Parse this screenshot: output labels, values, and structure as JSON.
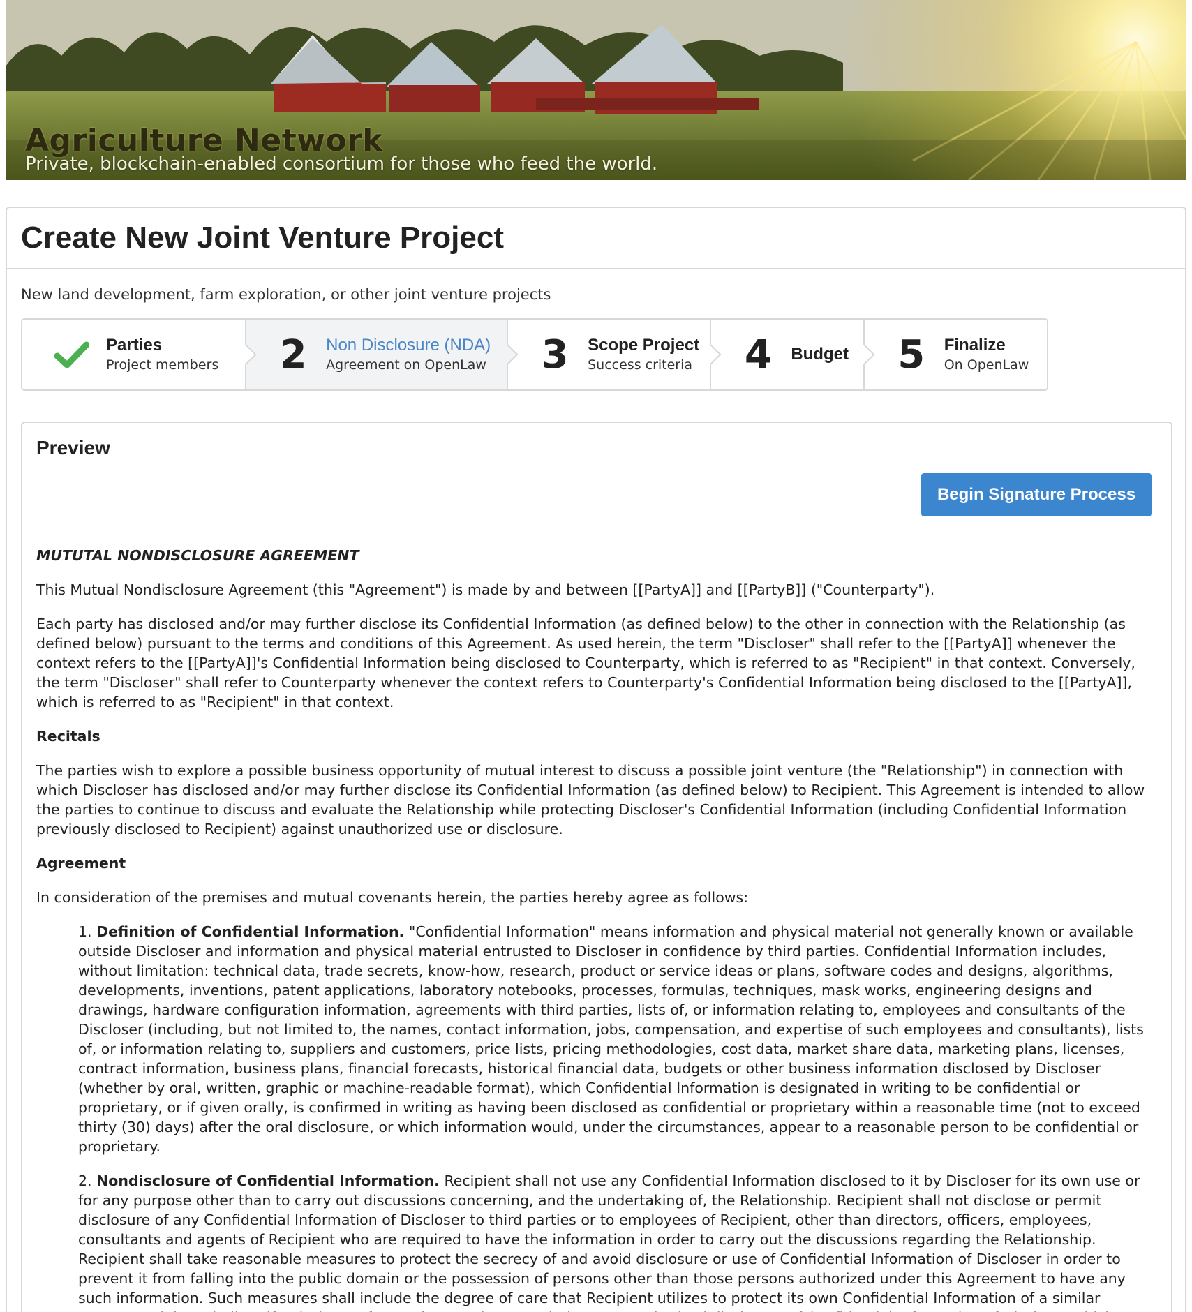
{
  "banner": {
    "title": "Agriculture Network",
    "subtitle": "Private, blockchain-enabled consortium for those who feed the world."
  },
  "page": {
    "title": "Create New Joint Venture Project",
    "description": "New land development, farm exploration, or other joint venture projects"
  },
  "steps": [
    {
      "marker": "check-icon",
      "title": "Parties",
      "subtitle": "Project members",
      "state": "completed"
    },
    {
      "marker": "2",
      "title": "Non Disclosure (NDA)",
      "subtitle": "Agreement on OpenLaw",
      "state": "active"
    },
    {
      "marker": "3",
      "title": "Scope Project",
      "subtitle": "Success criteria",
      "state": "pending"
    },
    {
      "marker": "4",
      "title": "Budget",
      "subtitle": "",
      "state": "pending"
    },
    {
      "marker": "5",
      "title": "Finalize",
      "subtitle": "On OpenLaw",
      "state": "pending"
    }
  ],
  "colors": {
    "accent": "#3b86cf",
    "active_step_text": "#4a86c8",
    "check": "#4caf50"
  },
  "preview": {
    "title": "Preview",
    "button_label": "Begin Signature Process",
    "document": {
      "heading": "MUTUTAL NONDISCLOSURE AGREEMENT",
      "intro": "This Mutual Nondisclosure Agreement (this \"Agreement\") is made by and between [[PartyA]] and [[PartyB]] (\"Counterparty\").",
      "para1": "Each party has disclosed and/or may further disclose its Confidential Information (as defined below) to the other in connection with the Relationship (as defined below) pursuant to the terms and conditions of this Agreement. As used herein, the term \"Discloser\" shall refer to the [[PartyA]] whenever the context refers to the [[PartyA]]'s Confidential Information being disclosed to Counterparty, which is referred to as \"Recipient\" in that context. Conversely, the term \"Discloser\" shall refer to Counterparty whenever the context refers to Counterparty's Confidential Information being disclosed to the [[PartyA]], which is referred to as \"Recipient\" in that context.",
      "recitals_heading": "Recitals",
      "recitals": "The parties wish to explore a possible business opportunity of mutual interest to discuss a possible joint venture (the \"Relationship\") in connection with which Discloser has disclosed and/or may further disclose its Confidential Information (as defined below) to Recipient. This Agreement is intended to allow the parties to continue to discuss and evaluate the Relationship while protecting Discloser's Confidential Information (including Confidential Information previously disclosed to Recipient) against unauthorized use or disclosure.",
      "agreement_heading": "Agreement",
      "agreement_intro": "In consideration of the premises and mutual covenants herein, the parties hereby agree as follows:",
      "clauses": [
        {
          "number": "1.",
          "title": "Definition of Confidential Information.",
          "text": "\"Confidential Information\" means information and physical material not generally known or available outside Discloser and information and physical material entrusted to Discloser in confidence by third parties. Confidential Information includes, without limitation: technical data, trade secrets, know-how, research, product or service ideas or plans, software codes and designs, algorithms, developments, inventions, patent applications, laboratory notebooks, processes, formulas, techniques, mask works, engineering designs and drawings, hardware configuration information, agreements with third parties, lists of, or information relating to, employees and consultants of the Discloser (including, but not limited to, the names, contact information, jobs, compensation, and expertise of such employees and consultants), lists of, or information relating to, suppliers and customers, price lists, pricing methodologies, cost data, market share data, marketing plans, licenses, contract information, business plans, financial forecasts, historical financial data, budgets or other business information disclosed by Discloser (whether by oral, written, graphic or machine-readable format), which Confidential Information is designated in writing to be confidential or proprietary, or if given orally, is confirmed in writing as having been disclosed as confidential or proprietary within a reasonable time (not to exceed thirty (30) days) after the oral disclosure, or which information would, under the circumstances, appear to a reasonable person to be confidential or proprietary."
        },
        {
          "number": "2.",
          "title": "Nondisclosure of Confidential Information.",
          "text": "Recipient shall not use any Confidential Information disclosed to it by Discloser for its own use or for any purpose other than to carry out discussions concerning, and the undertaking of, the Relationship. Recipient shall not disclose or permit disclosure of any Confidential Information of Discloser to third parties or to employees of Recipient, other than directors, officers, employees, consultants and agents of Recipient who are required to have the information in order to carry out the discussions regarding the Relationship. Recipient shall take reasonable measures to protect the secrecy of and avoid disclosure or use of Confidential Information of Discloser in order to prevent it from falling into the public domain or the possession of persons other than those persons authorized under this Agreement to have any such information. Such measures shall include the degree of care that Recipient utilizes to protect its own Confidential Information of a similar nature. Recipient shall notify Discloser of any misuse, misappropriation or unauthorized disclosure of Confidential Information of Discloser which may come to Recipient's attention."
        }
      ]
    }
  }
}
